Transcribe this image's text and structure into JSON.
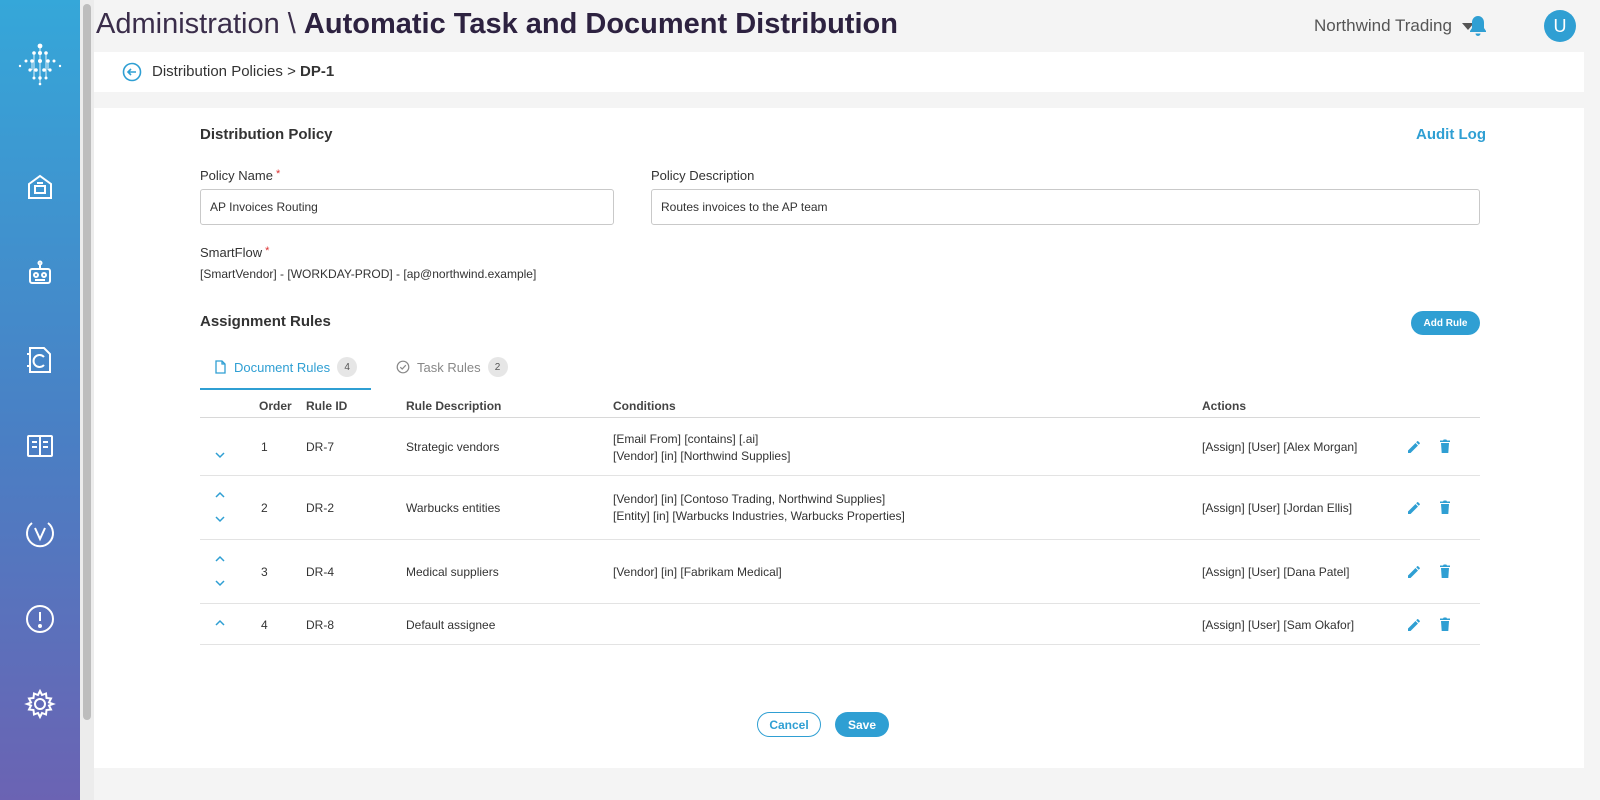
{
  "header": {
    "title_prefix": "Administration \\",
    "title_main": "Automatic Task and Document Distribution",
    "org_name": "Northwind Trading",
    "avatar_initial": "U"
  },
  "sidebar": {
    "items": [
      {
        "icon": "home-icon"
      },
      {
        "icon": "robot-icon"
      },
      {
        "icon": "c-document-icon"
      },
      {
        "icon": "book-icon"
      },
      {
        "icon": "v-badge-icon"
      },
      {
        "icon": "alert-icon"
      },
      {
        "icon": "gear-icon"
      }
    ]
  },
  "breadcrumb": {
    "parent": "Distribution Policies",
    "separator": ">",
    "current": "DP-1"
  },
  "policy": {
    "section_title": "Distribution Policy",
    "audit_log": "Audit Log",
    "name_label": "Policy Name",
    "name_value": "AP Invoices Routing",
    "description_label": "Policy Description",
    "description_value": "Routes invoices to the AP team",
    "smartflow_label": "SmartFlow",
    "smartflow_value": "[SmartVendor] - [WORKDAY-PROD] - [ap@northwind.example]",
    "required_marker": "*"
  },
  "rules": {
    "section_title": "Assignment Rules",
    "add_rule": "Add Rule",
    "tabs": [
      {
        "label": "Document Rules",
        "count": "4"
      },
      {
        "label": "Task Rules",
        "count": "2"
      }
    ],
    "columns": {
      "order": "Order",
      "rule_id": "Rule ID",
      "description": "Rule Description",
      "conditions": "Conditions",
      "actions": "Actions"
    },
    "rows": [
      {
        "order": "1",
        "rule_id": "DR-7",
        "description": "Strategic vendors",
        "condition_1": "[Email From] [contains] [.ai]",
        "condition_2": "[Vendor] [in] [Northwind Supplies]",
        "action": "[Assign] [User] [Alex Morgan]"
      },
      {
        "order": "2",
        "rule_id": "DR-2",
        "description": "Warbucks entities",
        "condition_1": "[Vendor] [in] [Contoso Trading, Northwind Supplies]",
        "condition_2": "[Entity] [in] [Warbucks Industries, Warbucks Properties]",
        "action": "[Assign] [User] [Jordan Ellis]"
      },
      {
        "order": "3",
        "rule_id": "DR-4",
        "description": "Medical suppliers",
        "condition_1": "[Vendor] [in] [Fabrikam Medical]",
        "condition_2": "",
        "action": "[Assign] [User] [Dana Patel]"
      },
      {
        "order": "4",
        "rule_id": "DR-8",
        "description": "Default assignee",
        "condition_1": "",
        "condition_2": "",
        "action": "[Assign] [User] [Sam Okafor]"
      }
    ]
  },
  "footer": {
    "cancel": "Cancel",
    "save": "Save"
  },
  "colors": {
    "accent": "#2f9fd3",
    "title": "#2d2240",
    "sidebar_top": "#35a7d9",
    "sidebar_bottom": "#6b63b3"
  }
}
